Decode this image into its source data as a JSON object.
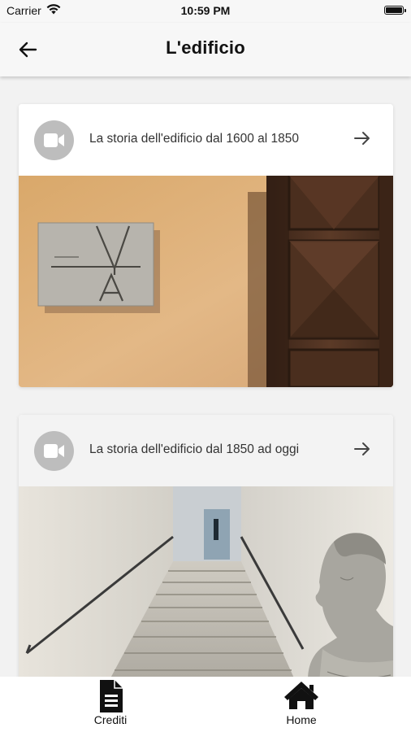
{
  "status_bar": {
    "carrier": "Carrier",
    "time": "10:59 PM",
    "battery_level": 1.0
  },
  "app_bar": {
    "back_icon": "arrow-left-icon",
    "title": "L'edificio"
  },
  "cards": [
    {
      "icon": "video-camera-icon",
      "title": "La storia dell'edificio dal 1600 al 1850",
      "action_icon": "arrow-right-icon",
      "image": "wall-plaque-and-wooden-door-photo"
    },
    {
      "icon": "video-camera-icon",
      "title": "La storia dell'edificio dal 1850 ad oggi",
      "action_icon": "arrow-right-icon",
      "image": "staircase-and-bust-photo"
    }
  ],
  "tab_bar": {
    "items": [
      {
        "label": "Crediti",
        "icon": "document-icon"
      },
      {
        "label": "Home",
        "icon": "home-icon"
      }
    ]
  },
  "colors": {
    "background": "#f2f2f2",
    "card": "#ffffff",
    "icon_badge": "#bdbdbd",
    "text": "#333333"
  }
}
